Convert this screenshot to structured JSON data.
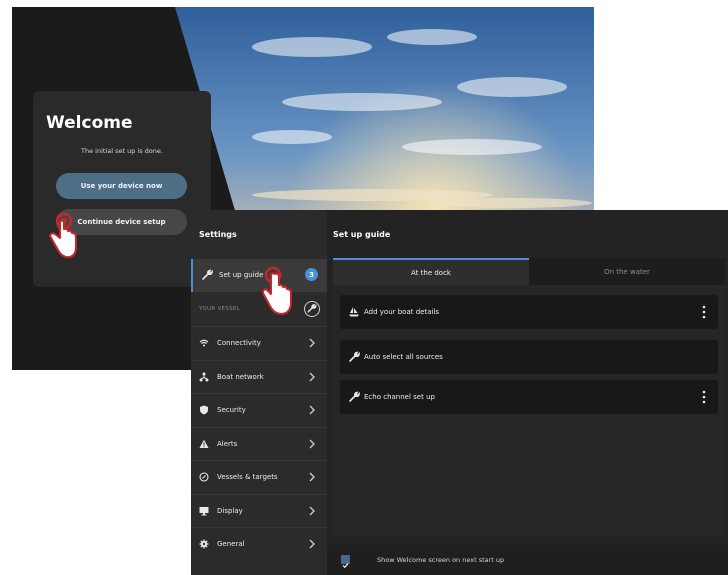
{
  "welcome": {
    "title": "Welcome",
    "subtitle": "The initial set up is done.",
    "use_device_label": "Use your device now",
    "continue_setup_label": "Continue device setup"
  },
  "settings": {
    "title": "Settings",
    "active_item": {
      "label": "Set up guide",
      "badge": "3",
      "icon": "wrench-icon"
    },
    "section_label": "YOUR VESSEL",
    "nav_items": [
      {
        "label": "Connectivity",
        "icon": "wifi-icon"
      },
      {
        "label": "Boat network",
        "icon": "network-icon"
      },
      {
        "label": "Security",
        "icon": "shield-icon"
      },
      {
        "label": "Alerts",
        "icon": "alert-triangle-icon"
      },
      {
        "label": "Vessels & targets",
        "icon": "target-icon"
      },
      {
        "label": "Display",
        "icon": "display-icon"
      },
      {
        "label": "General",
        "icon": "gear-icon"
      }
    ]
  },
  "guide": {
    "title": "Set up guide",
    "tabs": [
      "At the dock",
      "On the water"
    ],
    "tasks": [
      {
        "label": "Add your boat details",
        "icon": "boat-icon",
        "has_menu": true
      },
      {
        "label": "Auto select all sources",
        "icon": "wrench-icon",
        "has_menu": false
      },
      {
        "label": "Echo channel set up",
        "icon": "wrench-icon",
        "has_menu": true
      }
    ],
    "footer_label": "Show Welcome screen on next start up",
    "footer_checked": true
  },
  "colors": {
    "accent": "#4a90d9",
    "primary_button": "#4d6f86",
    "panel_bg": "#232323",
    "tap_indicator": "#c8262c"
  }
}
